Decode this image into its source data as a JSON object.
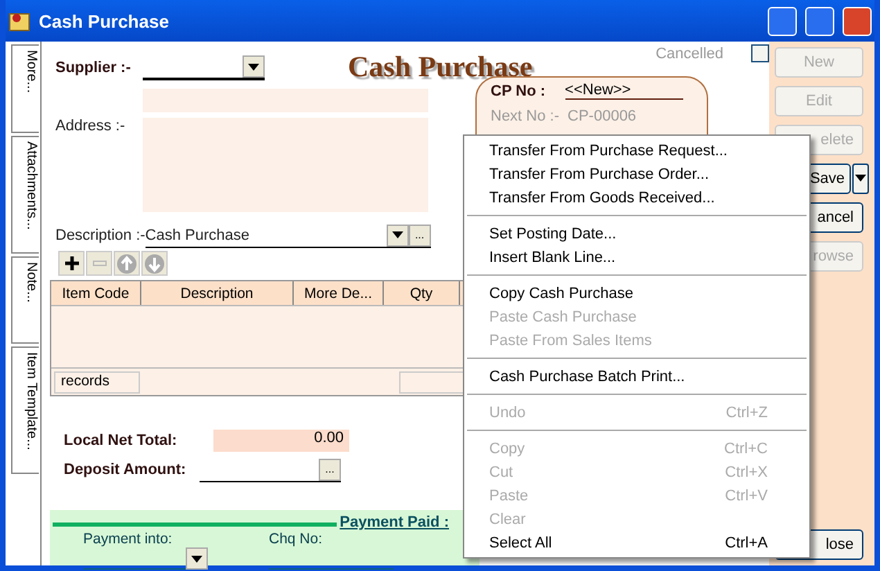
{
  "window": {
    "title": "Cash Purchase"
  },
  "side_tabs": [
    "More...",
    "Attachments...",
    "Note...",
    "Item Template..."
  ],
  "heading": "Cash Purchase",
  "cancelled": {
    "label": "Cancelled",
    "checked": false
  },
  "supplier": {
    "label": "Supplier :-"
  },
  "address": {
    "label": "Address :-"
  },
  "description": {
    "label": "Description :-",
    "value": "Cash Purchase",
    "more": "..."
  },
  "cp_no": {
    "label": "CP No :",
    "value": "<<New>>",
    "next_label": "Next No :-",
    "next_value": "CP-00006"
  },
  "grid": {
    "columns": [
      "Item Code",
      "Description",
      "More De...",
      " Qty"
    ],
    "footer": "records"
  },
  "local_net_total": {
    "label": "Local Net Total:",
    "value": "0.00"
  },
  "deposit_amount": {
    "label": "Deposit Amount:",
    "more": "..."
  },
  "payment": {
    "title": "Payment Paid :",
    "fields": [
      "Payment into:",
      "Chq No:"
    ]
  },
  "buttons": [
    {
      "label": "New",
      "disabled": true
    },
    {
      "label": "Edit",
      "disabled": true
    },
    {
      "label": "elete",
      "disabled": true
    },
    {
      "label": "Save",
      "disabled": false,
      "split": true
    },
    {
      "label": "ancel",
      "disabled": false
    },
    {
      "label": "rowse",
      "disabled": true
    }
  ],
  "close_button": "lose",
  "context_menu": [
    {
      "kind": "item",
      "label": "Transfer From Purchase Request...",
      "disabled": false
    },
    {
      "kind": "item",
      "label": "Transfer From Purchase Order...",
      "disabled": false
    },
    {
      "kind": "item",
      "label": "Transfer From Goods Received...",
      "disabled": false
    },
    {
      "kind": "separator"
    },
    {
      "kind": "item",
      "label": "Set Posting Date...",
      "disabled": false
    },
    {
      "kind": "item",
      "label": "Insert Blank Line...",
      "disabled": false
    },
    {
      "kind": "separator"
    },
    {
      "kind": "item",
      "label": "Copy Cash Purchase",
      "disabled": false
    },
    {
      "kind": "item",
      "label": "Paste Cash Purchase",
      "disabled": true
    },
    {
      "kind": "item",
      "label": "Paste From Sales Items",
      "disabled": true
    },
    {
      "kind": "separator"
    },
    {
      "kind": "item",
      "label": "Cash Purchase Batch Print...",
      "disabled": false
    },
    {
      "kind": "separator"
    },
    {
      "kind": "item",
      "label": "Undo",
      "shortcut": "Ctrl+Z",
      "disabled": true
    },
    {
      "kind": "separator"
    },
    {
      "kind": "item",
      "label": "Copy",
      "shortcut": "Ctrl+C",
      "disabled": true
    },
    {
      "kind": "item",
      "label": "Cut",
      "shortcut": "Ctrl+X",
      "disabled": true
    },
    {
      "kind": "item",
      "label": "Paste",
      "shortcut": "Ctrl+V",
      "disabled": true
    },
    {
      "kind": "item",
      "label": "Clear",
      "disabled": true
    },
    {
      "kind": "item",
      "label": "Select All",
      "shortcut": "Ctrl+A",
      "disabled": false
    }
  ]
}
